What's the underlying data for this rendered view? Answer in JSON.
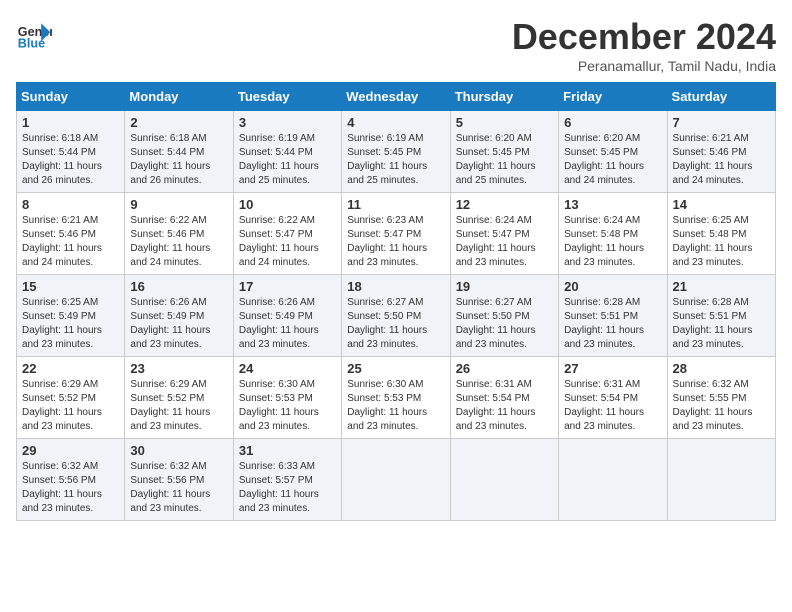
{
  "header": {
    "logo_line1": "General",
    "logo_line2": "Blue",
    "month": "December 2024",
    "location": "Peranamallur, Tamil Nadu, India"
  },
  "weekdays": [
    "Sunday",
    "Monday",
    "Tuesday",
    "Wednesday",
    "Thursday",
    "Friday",
    "Saturday"
  ],
  "weeks": [
    [
      {
        "day": "1",
        "info": "Sunrise: 6:18 AM\nSunset: 5:44 PM\nDaylight: 11 hours\nand 26 minutes."
      },
      {
        "day": "2",
        "info": "Sunrise: 6:18 AM\nSunset: 5:44 PM\nDaylight: 11 hours\nand 26 minutes."
      },
      {
        "day": "3",
        "info": "Sunrise: 6:19 AM\nSunset: 5:44 PM\nDaylight: 11 hours\nand 25 minutes."
      },
      {
        "day": "4",
        "info": "Sunrise: 6:19 AM\nSunset: 5:45 PM\nDaylight: 11 hours\nand 25 minutes."
      },
      {
        "day": "5",
        "info": "Sunrise: 6:20 AM\nSunset: 5:45 PM\nDaylight: 11 hours\nand 25 minutes."
      },
      {
        "day": "6",
        "info": "Sunrise: 6:20 AM\nSunset: 5:45 PM\nDaylight: 11 hours\nand 24 minutes."
      },
      {
        "day": "7",
        "info": "Sunrise: 6:21 AM\nSunset: 5:46 PM\nDaylight: 11 hours\nand 24 minutes."
      }
    ],
    [
      {
        "day": "8",
        "info": "Sunrise: 6:21 AM\nSunset: 5:46 PM\nDaylight: 11 hours\nand 24 minutes."
      },
      {
        "day": "9",
        "info": "Sunrise: 6:22 AM\nSunset: 5:46 PM\nDaylight: 11 hours\nand 24 minutes."
      },
      {
        "day": "10",
        "info": "Sunrise: 6:22 AM\nSunset: 5:47 PM\nDaylight: 11 hours\nand 24 minutes."
      },
      {
        "day": "11",
        "info": "Sunrise: 6:23 AM\nSunset: 5:47 PM\nDaylight: 11 hours\nand 23 minutes."
      },
      {
        "day": "12",
        "info": "Sunrise: 6:24 AM\nSunset: 5:47 PM\nDaylight: 11 hours\nand 23 minutes."
      },
      {
        "day": "13",
        "info": "Sunrise: 6:24 AM\nSunset: 5:48 PM\nDaylight: 11 hours\nand 23 minutes."
      },
      {
        "day": "14",
        "info": "Sunrise: 6:25 AM\nSunset: 5:48 PM\nDaylight: 11 hours\nand 23 minutes."
      }
    ],
    [
      {
        "day": "15",
        "info": "Sunrise: 6:25 AM\nSunset: 5:49 PM\nDaylight: 11 hours\nand 23 minutes."
      },
      {
        "day": "16",
        "info": "Sunrise: 6:26 AM\nSunset: 5:49 PM\nDaylight: 11 hours\nand 23 minutes."
      },
      {
        "day": "17",
        "info": "Sunrise: 6:26 AM\nSunset: 5:49 PM\nDaylight: 11 hours\nand 23 minutes."
      },
      {
        "day": "18",
        "info": "Sunrise: 6:27 AM\nSunset: 5:50 PM\nDaylight: 11 hours\nand 23 minutes."
      },
      {
        "day": "19",
        "info": "Sunrise: 6:27 AM\nSunset: 5:50 PM\nDaylight: 11 hours\nand 23 minutes."
      },
      {
        "day": "20",
        "info": "Sunrise: 6:28 AM\nSunset: 5:51 PM\nDaylight: 11 hours\nand 23 minutes."
      },
      {
        "day": "21",
        "info": "Sunrise: 6:28 AM\nSunset: 5:51 PM\nDaylight: 11 hours\nand 23 minutes."
      }
    ],
    [
      {
        "day": "22",
        "info": "Sunrise: 6:29 AM\nSunset: 5:52 PM\nDaylight: 11 hours\nand 23 minutes."
      },
      {
        "day": "23",
        "info": "Sunrise: 6:29 AM\nSunset: 5:52 PM\nDaylight: 11 hours\nand 23 minutes."
      },
      {
        "day": "24",
        "info": "Sunrise: 6:30 AM\nSunset: 5:53 PM\nDaylight: 11 hours\nand 23 minutes."
      },
      {
        "day": "25",
        "info": "Sunrise: 6:30 AM\nSunset: 5:53 PM\nDaylight: 11 hours\nand 23 minutes."
      },
      {
        "day": "26",
        "info": "Sunrise: 6:31 AM\nSunset: 5:54 PM\nDaylight: 11 hours\nand 23 minutes."
      },
      {
        "day": "27",
        "info": "Sunrise: 6:31 AM\nSunset: 5:54 PM\nDaylight: 11 hours\nand 23 minutes."
      },
      {
        "day": "28",
        "info": "Sunrise: 6:32 AM\nSunset: 5:55 PM\nDaylight: 11 hours\nand 23 minutes."
      }
    ],
    [
      {
        "day": "29",
        "info": "Sunrise: 6:32 AM\nSunset: 5:56 PM\nDaylight: 11 hours\nand 23 minutes."
      },
      {
        "day": "30",
        "info": "Sunrise: 6:32 AM\nSunset: 5:56 PM\nDaylight: 11 hours\nand 23 minutes."
      },
      {
        "day": "31",
        "info": "Sunrise: 6:33 AM\nSunset: 5:57 PM\nDaylight: 11 hours\nand 23 minutes."
      },
      {
        "day": "",
        "info": ""
      },
      {
        "day": "",
        "info": ""
      },
      {
        "day": "",
        "info": ""
      },
      {
        "day": "",
        "info": ""
      }
    ]
  ]
}
